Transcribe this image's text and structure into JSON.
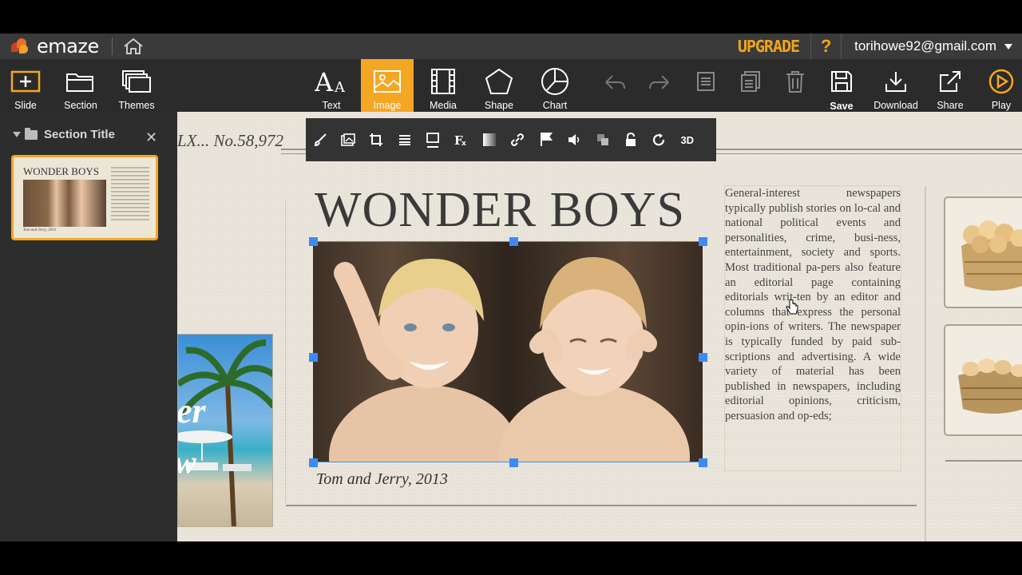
{
  "app": {
    "logo_text": "emaze",
    "upgrade_label": "UPGRADE",
    "help_label": "?",
    "account_email": "torihowe92@gmail.com"
  },
  "toolbar": {
    "left": [
      {
        "label": "Slide",
        "icon": "add-slide-icon"
      },
      {
        "label": "Section",
        "icon": "folder-icon"
      },
      {
        "label": "Themes",
        "icon": "themes-icon"
      }
    ],
    "insert": [
      {
        "label": "Text",
        "icon": "text-icon"
      },
      {
        "label": "Image",
        "icon": "image-icon",
        "active": true
      },
      {
        "label": "Media",
        "icon": "film-icon"
      },
      {
        "label": "Shape",
        "icon": "pentagon-icon"
      },
      {
        "label": "Chart",
        "icon": "pie-chart-icon"
      }
    ],
    "right": [
      {
        "label": "Save",
        "icon": "save-icon"
      },
      {
        "label": "Download",
        "icon": "download-icon"
      },
      {
        "label": "Share",
        "icon": "share-icon"
      },
      {
        "label": "Play",
        "icon": "play-icon"
      }
    ],
    "accent_color": "#f5a623"
  },
  "sidebar": {
    "section_title": "Section Title",
    "thumbnail": {
      "title": "WONDER BOYS",
      "caption": "Tom and Jerry, 2013"
    }
  },
  "image_toolbar": {
    "three_d_label": "3D"
  },
  "slide": {
    "issue_text": "LX... No.58,972",
    "headline": "WONDER BOYS",
    "caption": "Tom and Jerry, 2013",
    "article": "General-interest newspapers typically publish stories on lo-cal and national political events and personalities, crime, busi-ness, entertainment, society and sports. Most traditional pa-pers also feature an editorial page containing editorials writ-ten by an editor and columns that express the personal opin-ions of writers. The newspaper is typically funded by paid sub-scriptions and advertising. A wide variety of material has been published in newspapers, including editorial opinions, criticism, persuasion and op-eds;",
    "beach_text_1": "er",
    "beach_text_2": "w",
    "selection_color": "#3d8bf2"
  }
}
